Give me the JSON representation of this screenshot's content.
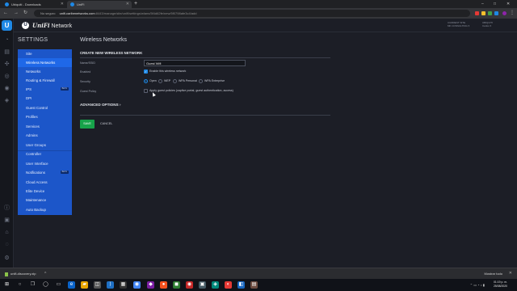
{
  "browser": {
    "tabs": [
      {
        "title": "Ubiquiti - Downloads"
      },
      {
        "title": "UniFi"
      }
    ],
    "new_tab": "+",
    "window_controls": {
      "minimize": "–",
      "maximize": "□",
      "close": "✕"
    },
    "security_label": "No seguro",
    "url_host": "unifi.caribenetworks.com",
    "url_path": ":8443/manage/site/unifi/settings/wlans/5f4d62fe/new/5f0798afe3c4/add"
  },
  "app": {
    "brand_logo_letter": "U",
    "brand_name": "UniFi",
    "brand_suffix": "Network",
    "right_info": [
      {
        "line1": "CURRENT SITE",
        "line2": "MK CONSULTING ▾"
      },
      {
        "line1": "UBIQUITI",
        "line2": "Carlos ▾"
      }
    ]
  },
  "settings": {
    "title": "SETTINGS",
    "items": [
      {
        "label": "Site",
        "active": false
      },
      {
        "label": "Wireless Networks",
        "active": true
      },
      {
        "label": "Networks",
        "active": false
      },
      {
        "label": "Routing & Firewall",
        "active": false
      },
      {
        "label": "IPS",
        "active": false,
        "badge": "BETA"
      },
      {
        "label": "DPI",
        "active": false
      },
      {
        "label": "Guest Control",
        "active": false
      },
      {
        "label": "Profiles",
        "active": false
      },
      {
        "label": "Services",
        "active": false
      },
      {
        "label": "Admins",
        "active": false
      },
      {
        "label": "User Groups",
        "active": false
      },
      {
        "label": "Controller",
        "active": false
      },
      {
        "label": "User Interface",
        "active": false
      },
      {
        "label": "Notifications",
        "active": false,
        "badge": "BETA"
      },
      {
        "label": "Cloud Access",
        "active": false
      },
      {
        "label": "Elite Device",
        "active": false
      },
      {
        "label": "Maintenance",
        "active": false
      },
      {
        "label": "Auto Backup",
        "active": false
      }
    ]
  },
  "main": {
    "title": "Wireless Networks",
    "section_header": "CREATE NEW WIRELESS NETWORK",
    "fields": {
      "name_label": "Name/SSID",
      "name_value": "Guest Wifi",
      "enabled_label": "Enabled",
      "enabled_text": "Enable this wireless network",
      "security_label": "Security",
      "security_options": [
        "Open",
        "WEP",
        "WPA Personal",
        "WPA Enterprise"
      ],
      "security_selected": "Open",
      "guest_policy_label": "Guest Policy",
      "guest_policy_text": "Apply guest policies (captive portal, guest authentication, access)"
    },
    "advanced_options": "ADVANCED OPTIONS",
    "save_label": "SAVE",
    "cancel_label": "CANCEL"
  },
  "downloads": {
    "file_name": "unifi-discovery.zip",
    "more": "^",
    "show_all": "Mostrar todo",
    "close": "✕"
  },
  "taskbar": {
    "time": "01:19 p. m.",
    "date": "25/08/2020"
  },
  "colors": {
    "sidebar_bg": "#1c56c9",
    "sidebar_active": "#1f68e8",
    "accent": "#1e88e5",
    "save": "#17a34a",
    "page_bg": "#1c1e26"
  }
}
